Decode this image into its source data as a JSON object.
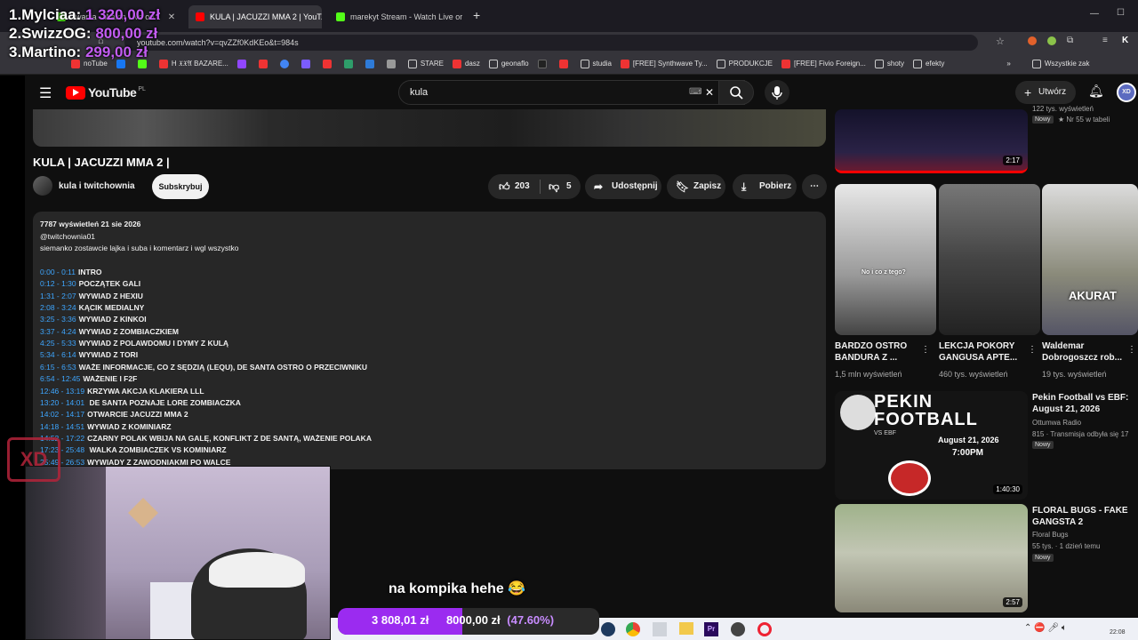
{
  "overlay": {
    "leaderboard": [
      {
        "name": "1.Mylciaa:",
        "amount": "1 320,00 zł"
      },
      {
        "name": "2.SwizzOG:",
        "amount": "800,00 zł"
      },
      {
        "name": "3.Martino:",
        "amount": "299,00 zł"
      }
    ],
    "goal": {
      "current": "3 808,01 zł",
      "target": "8000,00 zł",
      "percent_label": "(47.60%)",
      "fraction": 0.476
    },
    "subtitle": "na kompika hehe 😂",
    "logo_text": "XD"
  },
  "browser": {
    "tabs": [
      {
        "label": "owania - Watch Live on...",
        "color": "#53fc18"
      },
      {
        "label": "KULA | JACUZZI MMA 2 | YouT...",
        "color": "#ff0000",
        "active": true
      },
      {
        "label": "marekyt Stream - Watch Live or...",
        "color": "#53fc18"
      }
    ],
    "new_tab": "+",
    "url": "youtube.com/watch?v=qvZZf0KdKEo&t=984s",
    "profile_initial": "K",
    "bookmarks": [
      "noTube",
      "H 𝔛𝔛𝔄 BAZARE...",
      "STARE",
      "dasz",
      "geonaflo",
      "studia",
      "[FREE] Synthwave Ty...",
      "PRODUKCJE",
      "[FREE] Fivio Foreign...",
      "shoty",
      "efekty"
    ],
    "bookmarks_more": "»",
    "all_bookmarks": "Wszystkie zak"
  },
  "youtube": {
    "logo": "YouTube",
    "logo_region": "PL",
    "search_value": "kula",
    "create_label": "Utwórz",
    "video": {
      "title": "KULA | JACUZZI MMA 2 |",
      "channel": "kula i twitchownia",
      "subscribe": "Subskrybuj",
      "likes": "203",
      "dislikes": "5",
      "share": "Udostępnij",
      "save": "Zapisz",
      "download": "Pobierz",
      "more": "⋯"
    },
    "description": {
      "meta": "7787 wyświetleń  21 sie 2026",
      "handle": "@twitchownia01",
      "intro": "siemanko zostawcie lajka i suba i komentarz i wgl wszystko",
      "chapters": [
        {
          "t": "0:00 - 0:11",
          "label": "INTRO"
        },
        {
          "t": "0:12 - 1:30",
          "label": "POCZĄTEK GALI"
        },
        {
          "t": "1:31 - 2:07",
          "label": "WYWIAD Z HEXIU"
        },
        {
          "t": "2:08 - 3:24",
          "label": "KĄCIK MEDIALNY"
        },
        {
          "t": "3:25 - 3:36",
          "label": "WYWIAD Z KINKOI"
        },
        {
          "t": "3:37 - 4:24",
          "label": "WYWIAD Z ZOMBIACZKIEM"
        },
        {
          "t": "4:25 - 5:33",
          "label": "WYWIAD Z POLAWDOMU I DYMY Z KULĄ"
        },
        {
          "t": "5:34 - 6:14",
          "label": "WYWIAD Z TORI"
        },
        {
          "t": "6:15 - 6:53",
          "label": "WAŻE INFORMACJE, CO Z SĘDZIĄ (LEQU), DE SANTA OSTRO O PRZECIWNIKU"
        },
        {
          "t": "6:54 - 12:45",
          "label": "WAŻENIE I F2F"
        },
        {
          "t": "12:46 - 13:19",
          "label": "KRZYWA AKCJA KLAKIERA LLL"
        },
        {
          "t": "13:20 - 14:01",
          "label": " DE SANTA POZNAJE LORE ZOMBIACZKA"
        },
        {
          "t": "14:02 - 14:17",
          "label": "OTWARCIE JACUZZI MMA 2"
        },
        {
          "t": "14:18 - 14:51",
          "label": "WYWIAD Z KOMINIARZ"
        },
        {
          "t": "14:52 - 17:22",
          "label": "CZARNY POLAK WBIJA NA GALĘ, KONFLIKT Z DE SANTĄ, WAŻENIE POLAKA"
        },
        {
          "t": "17:23 - 25:48",
          "label": " WALKA ZOMBIACZEK VS KOMINIARZ"
        },
        {
          "t": "25:49 - 26:53",
          "label": "WYWIADY Z ZAWODNIAKMI PO WALCE"
        }
      ]
    },
    "sidebar": {
      "top": {
        "duration": "2:17",
        "meta1": "122 tys. wyświetleń",
        "badge": "Nowy",
        "rank": "Nr 55 w tabeli"
      },
      "shorts": [
        {
          "title": "BARDZO OSTRO BANDURA Z ...",
          "views": "1,5 mln wyświetleń",
          "caption": "No i co z tego?"
        },
        {
          "title": "LEKCJA POKORY GANGUSA APTE...",
          "views": "460 tys. wyświetleń",
          "caption": ""
        },
        {
          "title": "Waldemar Dobrogoszcz rob...",
          "views": "19 tys. wyświetleń",
          "caption": "AKURAT"
        }
      ],
      "videos": [
        {
          "title": "Pekin Football vs EBF: August 21, 2026",
          "channel": "Ottumwa Radio",
          "meta": "815 · Transmisja odbyła się 17",
          "badge": "Nowy",
          "duration": "1:40:30",
          "thumb_title": "PEKIN FOOTBALL",
          "thumb_sub": "VS EBF",
          "thumb_date": "August 21, 2026",
          "thumb_time": "7:00PM"
        },
        {
          "title": "FLORAL BUGS - FAKE GANGSTA 2",
          "channel": "Floral Bugs",
          "meta": "55 tys. · 1 dzień temu",
          "badge": "Nowy",
          "duration": "2:57"
        }
      ]
    }
  },
  "taskbar": {
    "time": "22:08"
  },
  "colors": {
    "accent": "#9b2bf0",
    "yt_red": "#ff0000",
    "link": "#3ea6ff"
  }
}
